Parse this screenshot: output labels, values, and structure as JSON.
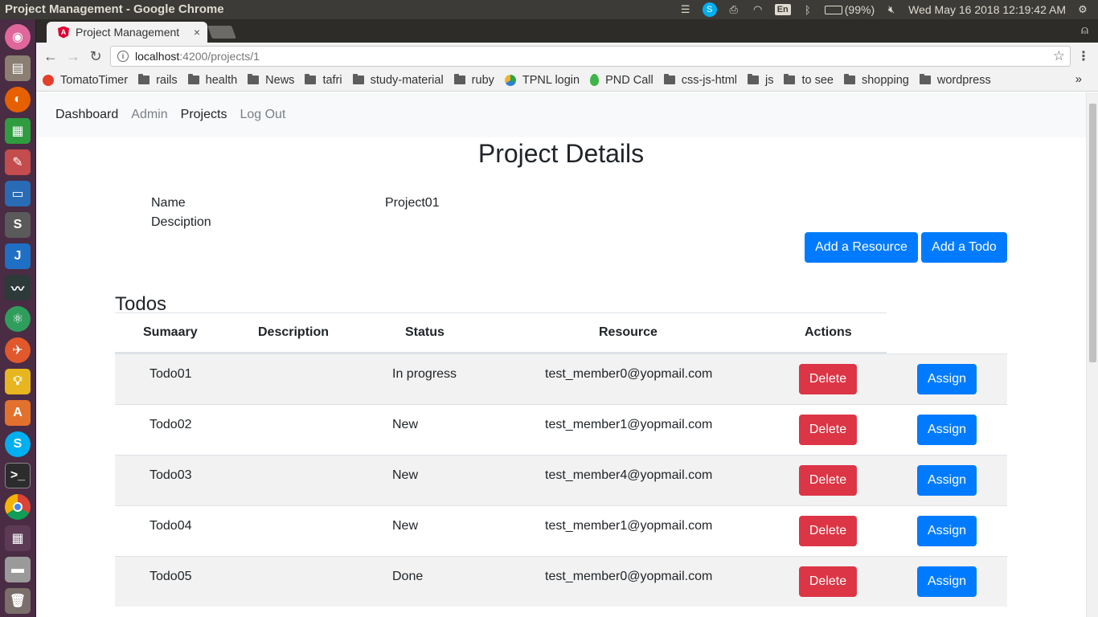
{
  "os": {
    "window_title": "Project Management - Google Chrome",
    "battery": "(99%)",
    "keyboard_layout": "En",
    "clock": "Wed May 16 2018 12:19:42 AM"
  },
  "browser": {
    "tab_title": "Project Management",
    "tab_close": "×",
    "url_host": "localhost",
    "url_rest": ":4200/projects/1",
    "bookmarks": [
      {
        "label": "TomatoTimer",
        "icon": "tomato-icon"
      },
      {
        "label": "rails",
        "icon": "folder-icon"
      },
      {
        "label": "health",
        "icon": "folder-icon"
      },
      {
        "label": "News",
        "icon": "folder-icon"
      },
      {
        "label": "tafri",
        "icon": "folder-icon"
      },
      {
        "label": "study-material",
        "icon": "folder-icon"
      },
      {
        "label": "ruby",
        "icon": "folder-icon"
      },
      {
        "label": "TPNL login",
        "icon": "tpnl-icon"
      },
      {
        "label": "PND Call",
        "icon": "pnd-icon"
      },
      {
        "label": "css-js-html",
        "icon": "folder-icon"
      },
      {
        "label": "js",
        "icon": "folder-icon"
      },
      {
        "label": "to see",
        "icon": "folder-icon"
      },
      {
        "label": "shopping",
        "icon": "folder-icon"
      },
      {
        "label": "wordpress",
        "icon": "folder-icon"
      }
    ],
    "bookmarks_more": "»"
  },
  "nav": {
    "dashboard": "Dashboard",
    "admin": "Admin",
    "projects": "Projects",
    "logout": "Log Out"
  },
  "project": {
    "page_title": "Project Details",
    "name_label": "Name",
    "name_value": "Project01",
    "description_label": "Desciption",
    "description_value": "",
    "add_resource_label": "Add a Resource",
    "add_todo_label": "Add a Todo"
  },
  "todos": {
    "section_title": "Todos",
    "headers": {
      "summary": "Sumaary",
      "description": "Description",
      "status": "Status",
      "resource": "Resource",
      "actions": "Actions"
    },
    "delete_label": "Delete",
    "assign_label": "Assign",
    "rows": [
      {
        "summary": "Todo01",
        "description": "",
        "status": "In progress",
        "resource": "test_member0@yopmail.com"
      },
      {
        "summary": "Todo02",
        "description": "",
        "status": "New",
        "resource": "test_member1@yopmail.com"
      },
      {
        "summary": "Todo03",
        "description": "",
        "status": "New",
        "resource": "test_member4@yopmail.com"
      },
      {
        "summary": "Todo04",
        "description": "",
        "status": "New",
        "resource": "test_member1@yopmail.com"
      },
      {
        "summary": "Todo05",
        "description": "",
        "status": "Done",
        "resource": "test_member0@yopmail.com"
      }
    ]
  },
  "colors": {
    "primary": "#007bff",
    "danger": "#dc3545",
    "launcher": "#4a2c44"
  }
}
